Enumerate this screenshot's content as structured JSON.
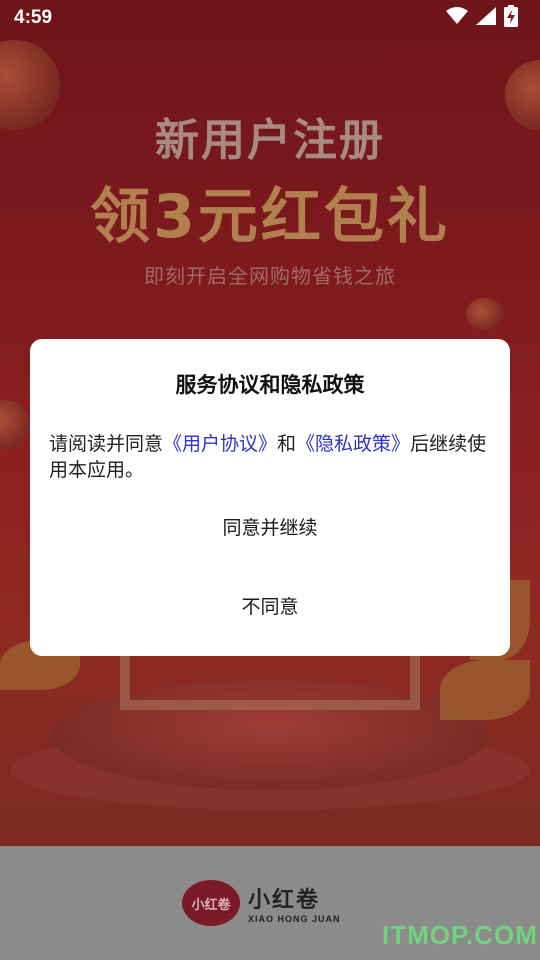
{
  "status_bar": {
    "time": "4:59",
    "icons": [
      "wifi-icon",
      "cellular-signal-icon",
      "battery-charging-icon"
    ]
  },
  "splash": {
    "headline_line1": "新用户注册",
    "headline_line2": "领3元红包礼",
    "subline": "即刻开启全网购物省钱之旅"
  },
  "dialog": {
    "title": "服务协议和隐私政策",
    "body_prefix": "请阅读并同意",
    "user_agreement_link": "《用户协议》",
    "body_and": "和",
    "privacy_policy_link": "《隐私政策》",
    "body_suffix": "后继续使用本应用。",
    "agree_button": "同意并继续",
    "disagree_button": "不同意"
  },
  "brand": {
    "logo_text": "小红卷",
    "name": "小红卷",
    "english_name": "XIAO HONG JUAN"
  },
  "watermark": "ITMOP.COM",
  "colors": {
    "link": "#2d34c8",
    "watermark": "#6fe07a"
  }
}
